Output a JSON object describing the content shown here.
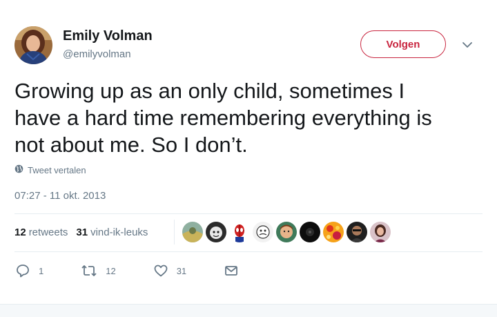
{
  "author": {
    "name": "Emily Volman",
    "handle": "@emilyvolman"
  },
  "follow_button": {
    "label": "Volgen"
  },
  "tweet": {
    "lines": [
      "Growing up as an only child, sometimes I",
      "have a hard time remembering everything is",
      "not about me. So I don’t."
    ],
    "translate_label": "Tweet vertalen",
    "timestamp": "07:27 - 11 okt. 2013"
  },
  "stats": {
    "retweets_count": "12",
    "retweets_label": "retweets",
    "likes_count": "31",
    "likes_label": "vind-ik-leuks"
  },
  "liker_avatars": [
    "liker-1",
    "liker-2",
    "liker-3",
    "liker-4",
    "liker-5",
    "liker-6",
    "liker-7",
    "liker-8",
    "liker-9"
  ],
  "actions": {
    "reply_count": "1",
    "retweet_count": "12",
    "like_count": "31"
  },
  "colors": {
    "follow_accent": "#c8243e",
    "secondary_text": "#657786",
    "primary_text": "#14171a"
  },
  "icons": [
    "chevron-down-icon",
    "globe-icon",
    "reply-icon",
    "retweet-icon",
    "heart-icon",
    "envelope-icon"
  ]
}
